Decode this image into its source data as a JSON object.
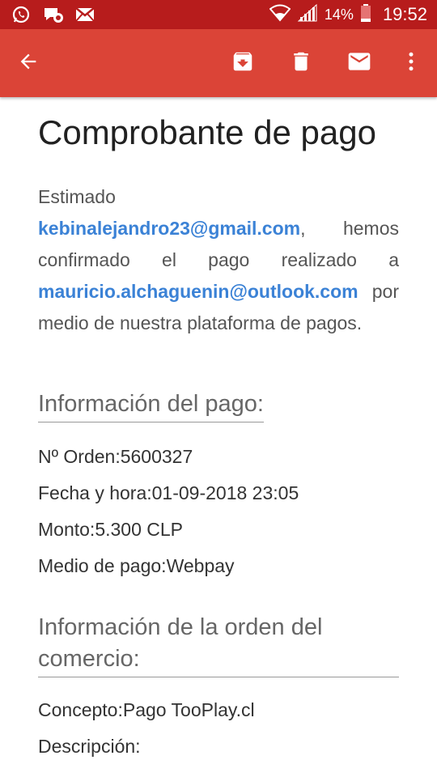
{
  "status_bar": {
    "battery_percent": "14%",
    "time": "19:52"
  },
  "app_bar": {
    "colors": {
      "background": "#db4437",
      "status": "#b71c1c"
    },
    "icons": [
      "arrow-back-icon",
      "archive-icon",
      "delete-icon",
      "mail-icon",
      "more-vert-icon"
    ]
  },
  "email": {
    "title": "Comprobante de pago",
    "greeting": "Estimado",
    "payer_email": "kebinalejandro23@gmail.com",
    "text_1": ", hemos confirmado el pago realizado a ",
    "payee_email": "mauricio.alchaguenin@outlook.com",
    "text_2": " por medio de nuestra plataforma de pagos.",
    "payment_section": {
      "heading": "Información del pago:",
      "rows": [
        {
          "label": "Nº Orden:",
          "value": "5600327"
        },
        {
          "label": "Fecha y hora:",
          "value": "01-09-2018 23:05"
        },
        {
          "label": "Monto:",
          "value": "5.300 CLP"
        },
        {
          "label": "Medio de pago:",
          "value": "Webpay"
        }
      ]
    },
    "order_section": {
      "heading": "Información de la orden del comercio:",
      "rows": [
        {
          "label": "Concepto:",
          "value": "Pago TooPlay.cl"
        },
        {
          "label": "Descripción:",
          "value": ""
        }
      ]
    }
  }
}
